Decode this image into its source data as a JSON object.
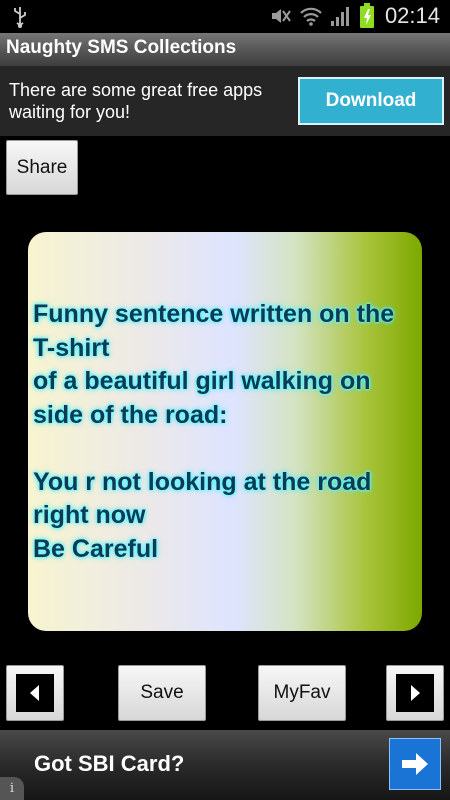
{
  "status_bar": {
    "time": "02:14"
  },
  "app": {
    "title": "Naughty SMS Collections"
  },
  "ad_banner": {
    "text": "There are some great free apps waiting for you!",
    "button_label": "Download",
    "button_color": "#31b0cf"
  },
  "toolbar": {
    "share_label": "Share"
  },
  "sms": {
    "text": "Funny sentence written on the T-shirt\nof a beautiful girl walking on side of the road:\n\nYou r not looking at the road right now\nBe Careful"
  },
  "nav": {
    "prev_icon": "left-triangle-icon",
    "save_label": "Save",
    "myfav_label": "MyFav",
    "next_icon": "right-triangle-icon"
  },
  "bottom_ad": {
    "text": "Got SBI Card?",
    "button_icon": "arrow-right-icon",
    "info_icon": "info-icon"
  }
}
